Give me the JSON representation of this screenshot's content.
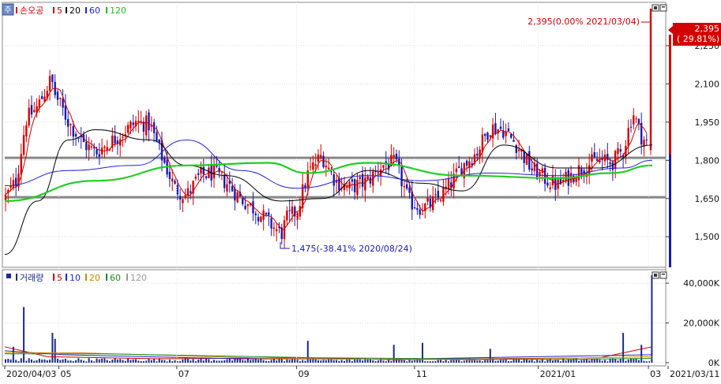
{
  "price_legend": {
    "icon_label": "주",
    "series": [
      {
        "label": "손오공",
        "color": "#cc0000"
      },
      {
        "label": "5",
        "color": "#cc0000"
      },
      {
        "label": "20",
        "color": "#000000"
      },
      {
        "label": "60",
        "color": "#2222cc"
      },
      {
        "label": "120",
        "color": "#22bb22"
      }
    ]
  },
  "volume_legend": {
    "series": [
      {
        "label": "거래량",
        "color": "#1a2a8c"
      },
      {
        "label": "5",
        "color": "#cc0000"
      },
      {
        "label": "10",
        "color": "#2222cc"
      },
      {
        "label": "20",
        "color": "#cc8800"
      },
      {
        "label": "60",
        "color": "#228822"
      },
      {
        "label": "120",
        "color": "#999999"
      }
    ]
  },
  "annotations": {
    "high": "2,395(0.00% 2021/03/04)",
    "low": "1,475(-38.41% 2020/08/24)",
    "current_price": "2,395",
    "current_change": "( 29.81%)"
  },
  "colors": {
    "up": "#d40000",
    "down": "#1a1ab0",
    "ma5": "#cc0000",
    "ma20": "#000000",
    "ma60": "#2222cc",
    "ma120": "#22cc22",
    "volume": "#1a2a8c",
    "support_line": "#888888"
  },
  "chart_data": [
    {
      "type": "candlestick",
      "title": "손오공",
      "x_start": "2020/04/03",
      "x_end": "2021/03/11",
      "ylim": [
        1380,
        2420
      ],
      "y_ticks": [
        "2,250",
        "2,100",
        "1,950",
        "1,800",
        "1,650",
        "1,500"
      ],
      "y_tick_values": [
        2250,
        2100,
        1950,
        1800,
        1650,
        1500
      ],
      "horizontal_lines": [
        1810,
        1655
      ],
      "x_labels": [
        "2020/04/03",
        "05",
        "07",
        "09",
        "11",
        "2021/01",
        "03",
        "2021/03/11"
      ],
      "x_label_dates": [
        "2020/04/03",
        "2020/05/01",
        "2020/07/01",
        "2020/09/01",
        "2020/11/01",
        "2021/01/04",
        "2021/03/02",
        "2021/03/11"
      ],
      "last_close": 2395,
      "high": {
        "value": 2395,
        "date": "2021/03/04"
      },
      "low": {
        "value": 1475,
        "date": "2020/08/24"
      },
      "price_path": [
        [
          "2020/04/03",
          1650
        ],
        [
          "2020/04/09",
          1720
        ],
        [
          "2020/04/14",
          1960
        ],
        [
          "2020/04/20",
          2010
        ],
        [
          "2020/04/27",
          2120
        ],
        [
          "2020/04/29",
          2060
        ],
        [
          "2020/05/06",
          1950
        ],
        [
          "2020/05/13",
          1870
        ],
        [
          "2020/05/20",
          1830
        ],
        [
          "2020/05/29",
          1880
        ],
        [
          "2020/06/10",
          1950
        ],
        [
          "2020/06/17",
          1940
        ],
        [
          "2020/06/24",
          1800
        ],
        [
          "2020/06/30",
          1690
        ],
        [
          "2020/07/06",
          1660
        ],
        [
          "2020/07/13",
          1740
        ],
        [
          "2020/07/20",
          1750
        ],
        [
          "2020/07/27",
          1710
        ],
        [
          "2020/08/03",
          1650
        ],
        [
          "2020/08/10",
          1610
        ],
        [
          "2020/08/17",
          1560
        ],
        [
          "2020/08/24",
          1510
        ],
        [
          "2020/08/27",
          1570
        ],
        [
          "2020/09/01",
          1600
        ],
        [
          "2020/09/07",
          1750
        ],
        [
          "2020/09/14",
          1820
        ],
        [
          "2020/09/21",
          1720
        ],
        [
          "2020/09/28",
          1690
        ],
        [
          "2020/10/08",
          1720
        ],
        [
          "2020/10/15",
          1780
        ],
        [
          "2020/10/22",
          1790
        ],
        [
          "2020/10/29",
          1640
        ],
        [
          "2020/11/05",
          1610
        ],
        [
          "2020/11/12",
          1640
        ],
        [
          "2020/11/19",
          1700
        ],
        [
          "2020/11/26",
          1780
        ],
        [
          "2020/12/03",
          1830
        ],
        [
          "2020/12/10",
          1930
        ],
        [
          "2020/12/17",
          1920
        ],
        [
          "2020/12/24",
          1860
        ],
        [
          "2020/12/31",
          1770
        ],
        [
          "2021/01/07",
          1730
        ],
        [
          "2021/01/14",
          1700
        ],
        [
          "2021/01/21",
          1740
        ],
        [
          "2021/01/28",
          1780
        ],
        [
          "2021/02/04",
          1800
        ],
        [
          "2021/02/11",
          1790
        ],
        [
          "2021/02/17",
          1840
        ],
        [
          "2021/02/22",
          1990
        ],
        [
          "2021/02/26",
          1900
        ],
        [
          "2021/03/03",
          1845
        ],
        [
          "2021/03/04",
          2395
        ]
      ],
      "moving_averages": [
        {
          "name": "20",
          "points": [
            [
              "2020/04/03",
              1430
            ],
            [
              "2020/04/20",
              1640
            ],
            [
              "2020/05/06",
              1880
            ],
            [
              "2020/05/20",
              1920
            ],
            [
              "2020/06/17",
              1880
            ],
            [
              "2020/07/06",
              1780
            ],
            [
              "2020/07/27",
              1740
            ],
            [
              "2020/08/24",
              1640
            ],
            [
              "2020/09/14",
              1650
            ],
            [
              "2020/10/08",
              1760
            ],
            [
              "2020/11/05",
              1710
            ],
            [
              "2020/11/26",
              1680
            ],
            [
              "2020/12/17",
              1860
            ],
            [
              "2021/01/14",
              1770
            ],
            [
              "2021/02/04",
              1770
            ],
            [
              "2021/03/04",
              1860
            ]
          ]
        },
        {
          "name": "60",
          "points": [
            [
              "2020/04/03",
              1700
            ],
            [
              "2020/05/06",
              1760
            ],
            [
              "2020/06/10",
              1780
            ],
            [
              "2020/07/06",
              1880
            ],
            [
              "2020/08/03",
              1760
            ],
            [
              "2020/09/01",
              1690
            ],
            [
              "2020/10/08",
              1740
            ],
            [
              "2020/11/05",
              1720
            ],
            [
              "2020/12/10",
              1750
            ],
            [
              "2021/01/14",
              1740
            ],
            [
              "2021/02/17",
              1770
            ],
            [
              "2021/03/04",
              1800
            ]
          ]
        },
        {
          "name": "120",
          "points": [
            [
              "2020/04/03",
              1640
            ],
            [
              "2020/05/20",
              1720
            ],
            [
              "2020/07/06",
              1780
            ],
            [
              "2020/08/17",
              1790
            ],
            [
              "2020/09/07",
              1750
            ],
            [
              "2020/10/08",
              1790
            ],
            [
              "2020/11/26",
              1740
            ],
            [
              "2021/01/14",
              1730
            ],
            [
              "2021/02/11",
              1750
            ],
            [
              "2021/03/04",
              1780
            ]
          ]
        }
      ]
    },
    {
      "type": "bar",
      "title": "거래량",
      "ylim": [
        0,
        46000
      ],
      "y_ticks": [
        "40,000K",
        "20,000K",
        "0K"
      ],
      "y_tick_values": [
        40000,
        20000,
        0
      ],
      "spikes": [
        {
          "date": "2020/04/13",
          "value": 28000
        },
        {
          "date": "2020/04/08",
          "value": 8000
        },
        {
          "date": "2020/04/27",
          "value": 15000
        },
        {
          "date": "2020/04/29",
          "value": 12000
        },
        {
          "date": "2020/09/07",
          "value": 11000
        },
        {
          "date": "2020/10/22",
          "value": 9000
        },
        {
          "date": "2020/11/05",
          "value": 10000
        },
        {
          "date": "2020/12/10",
          "value": 7000
        },
        {
          "date": "2021/02/17",
          "value": 15000
        },
        {
          "date": "2021/02/26",
          "value": 9000
        },
        {
          "date": "2021/03/04",
          "value": 44000
        }
      ],
      "base_level": 1500
    }
  ]
}
